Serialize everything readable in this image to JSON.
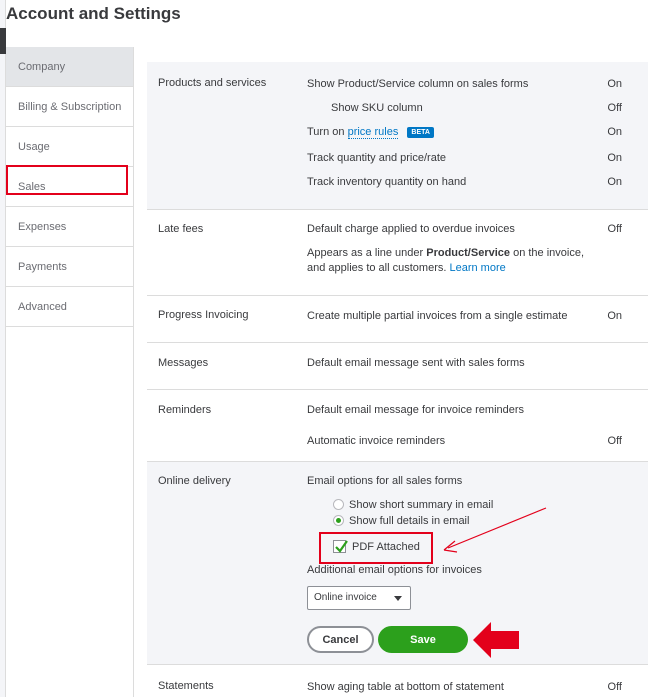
{
  "page": {
    "title": "Account and Settings"
  },
  "sidebar": {
    "items": [
      {
        "label": "Company",
        "active": true
      },
      {
        "label": "Billing & Subscription"
      },
      {
        "label": "Usage"
      },
      {
        "label": "Sales"
      },
      {
        "label": "Expenses"
      },
      {
        "label": "Payments"
      },
      {
        "label": "Advanced"
      }
    ]
  },
  "products": {
    "label": "Products and services",
    "rows": [
      {
        "text": "Show Product/Service column on sales forms",
        "value": "On"
      },
      {
        "text": "Show SKU column",
        "value": "Off"
      },
      {
        "text_prefix": "Turn on",
        "link": "price rules",
        "badge": "BETA",
        "value": "On"
      },
      {
        "text": "Track quantity and price/rate",
        "value": "On"
      },
      {
        "text": "Track inventory quantity on hand",
        "value": "On"
      }
    ]
  },
  "late_fees": {
    "label": "Late fees",
    "row1": "Default charge applied to overdue invoices",
    "value": "Off",
    "desc_a": "Appears as a line under ",
    "desc_bold": "Product/Service",
    "desc_b": " on the invoice,",
    "desc_c": "and applies to all customers. ",
    "learn_more": "Learn more"
  },
  "progress": {
    "label": "Progress Invoicing",
    "row": "Create multiple partial invoices from a single estimate",
    "value": "On"
  },
  "messages": {
    "label": "Messages",
    "row": "Default email message sent with sales forms"
  },
  "reminders": {
    "label": "Reminders",
    "row1": "Default email message for invoice reminders",
    "row2": "Automatic invoice reminders",
    "value": "Off"
  },
  "online_delivery": {
    "label": "Online delivery",
    "email_options": "Email options for all sales forms",
    "radio_summary": "Show short summary in email",
    "radio_full": "Show full details in email",
    "pdf_attached": "PDF Attached",
    "additional": "Additional email options for invoices",
    "select_value": "Online invoice",
    "cancel": "Cancel",
    "save": "Save"
  },
  "statements": {
    "label": "Statements",
    "row": "Show aging table at bottom of statement",
    "value": "Off"
  },
  "colors": {
    "accent_green": "#2ca01c",
    "link_blue": "#0077c5",
    "annotation_red": "#e3001b"
  }
}
